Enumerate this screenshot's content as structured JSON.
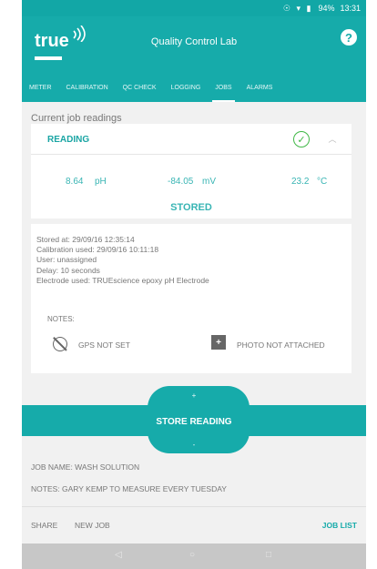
{
  "status_bar": {
    "battery": "94%",
    "time": "13:31",
    "icons": "☉ ▾ ▮"
  },
  "app": {
    "logo": "true",
    "title": "Quality Control Lab",
    "help_label": "?"
  },
  "tabs": [
    {
      "label": "METER",
      "active": false
    },
    {
      "label": "CALIBRATION",
      "active": false
    },
    {
      "label": "QC CHECK",
      "active": false
    },
    {
      "label": "LOGGING",
      "active": false
    },
    {
      "label": "JOBS",
      "active": true
    },
    {
      "label": "ALARMS",
      "active": false
    }
  ],
  "section": {
    "title": "Current job readings"
  },
  "reading": {
    "label": "READING",
    "ph_value": "8.64",
    "ph_unit": "pH",
    "mv_value": "-84.05",
    "mv_unit": "mV",
    "temp_value": "23.2",
    "temp_unit": "°C",
    "stored_label": "STORED"
  },
  "details": {
    "stored_at": "Stored at: 29/09/16 12:35:14",
    "calibration": "Calibration used: 29/09/16 10:11:18",
    "user": "User: unassigned",
    "delay": "Delay: 10 seconds",
    "electrode": "Electrode used: TRUEscience epoxy pH Electrode",
    "notes_label": "NOTES:",
    "gps": "GPS NOT SET",
    "photo": "PHOTO NOT ATTACHED"
  },
  "store": {
    "plus": "+",
    "label": "STORE READING",
    "minus": "-"
  },
  "job": {
    "name": "JOB NAME: WASH SOLUTION",
    "notes": "NOTES: GARY KEMP TO MEASURE EVERY TUESDAY"
  },
  "actions": {
    "share": "SHARE",
    "new_job": "NEW JOB",
    "job_list": "JOB LIST"
  },
  "navbar": {
    "back": "◁",
    "home": "○",
    "recents": "□"
  },
  "colors": {
    "primary": "#16abaa",
    "value_text": "#39b5b4",
    "check_green": "#41b847"
  }
}
